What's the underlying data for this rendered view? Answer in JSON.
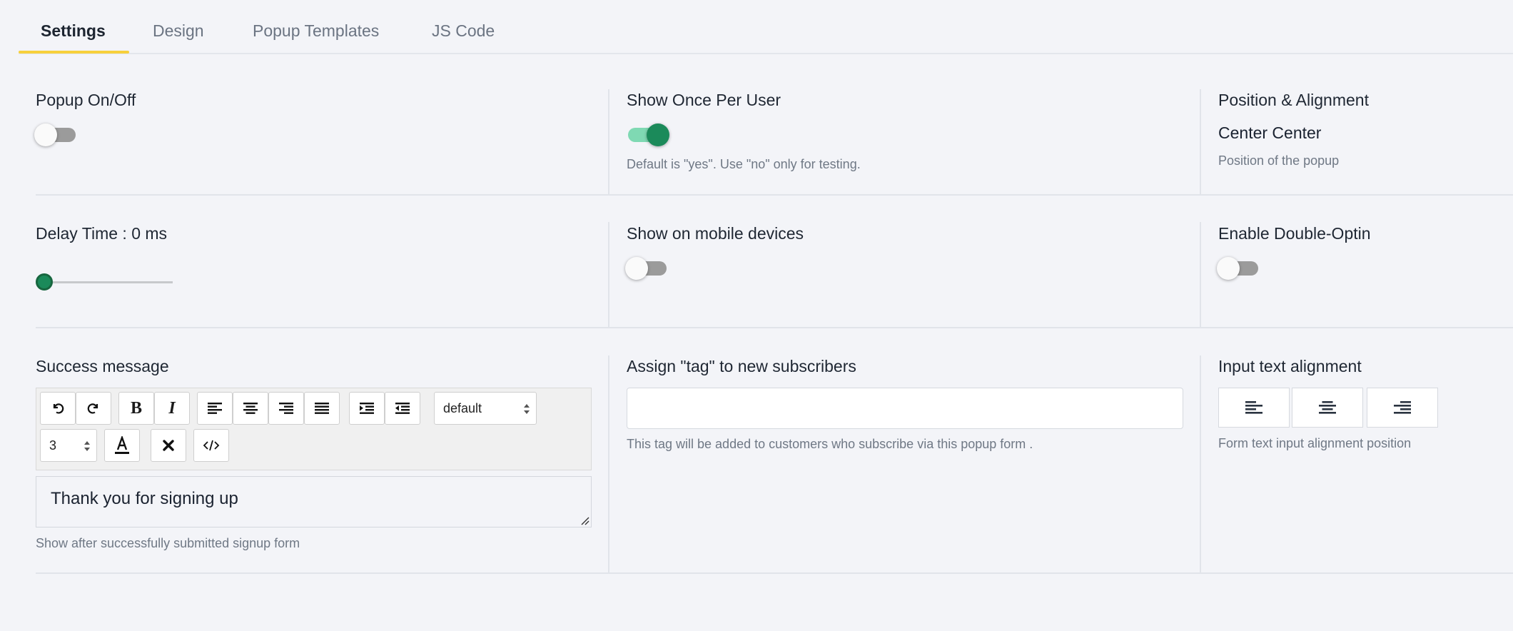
{
  "tabs": [
    {
      "label": "Settings",
      "active": true
    },
    {
      "label": "Design",
      "active": false
    },
    {
      "label": "Popup Templates",
      "active": false
    },
    {
      "label": "JS Code",
      "active": false
    }
  ],
  "popup_onoff": {
    "label": "Popup On/Off",
    "enabled": false
  },
  "show_once": {
    "label": "Show Once Per User",
    "enabled": true,
    "help": "Default is \"yes\". Use \"no\" only for testing."
  },
  "position": {
    "label": "Position & Alignment",
    "value": "Center Center",
    "help": "Position of the popup"
  },
  "delay": {
    "label": "Delay Time : 0 ms",
    "value_ms": 0
  },
  "show_mobile": {
    "label": "Show on mobile devices",
    "enabled": false
  },
  "double_optin": {
    "label": "Enable Double-Optin",
    "enabled": false
  },
  "success": {
    "label": "Success message",
    "toolbar": {
      "buttons": [
        "undo-icon",
        "redo-icon",
        "bold-icon",
        "italic-icon",
        "align-left-icon",
        "align-center-icon",
        "align-right-icon",
        "align-justify-icon",
        "indent-icon",
        "outdent-icon",
        "text-color-icon",
        "clear-format-icon",
        "code-view-icon"
      ],
      "font_select": "default",
      "size_select": "3"
    },
    "content": "Thank you for signing up",
    "help": "Show after successfully submitted signup form"
  },
  "assign_tag": {
    "label": "Assign \"tag\" to new subscribers",
    "value": "",
    "placeholder": "",
    "help": "This tag will be added to customers who subscribe via this popup form ."
  },
  "input_align": {
    "label": "Input text alignment",
    "options": [
      "align-left-icon",
      "align-center-icon",
      "align-right-icon"
    ],
    "help": "Form text input alignment position"
  },
  "colors": {
    "accent": "#f7d03c",
    "toggle_on": "#1b8a5a",
    "toggle_track_on": "#7fd9b3",
    "background": "#f3f4f8"
  }
}
